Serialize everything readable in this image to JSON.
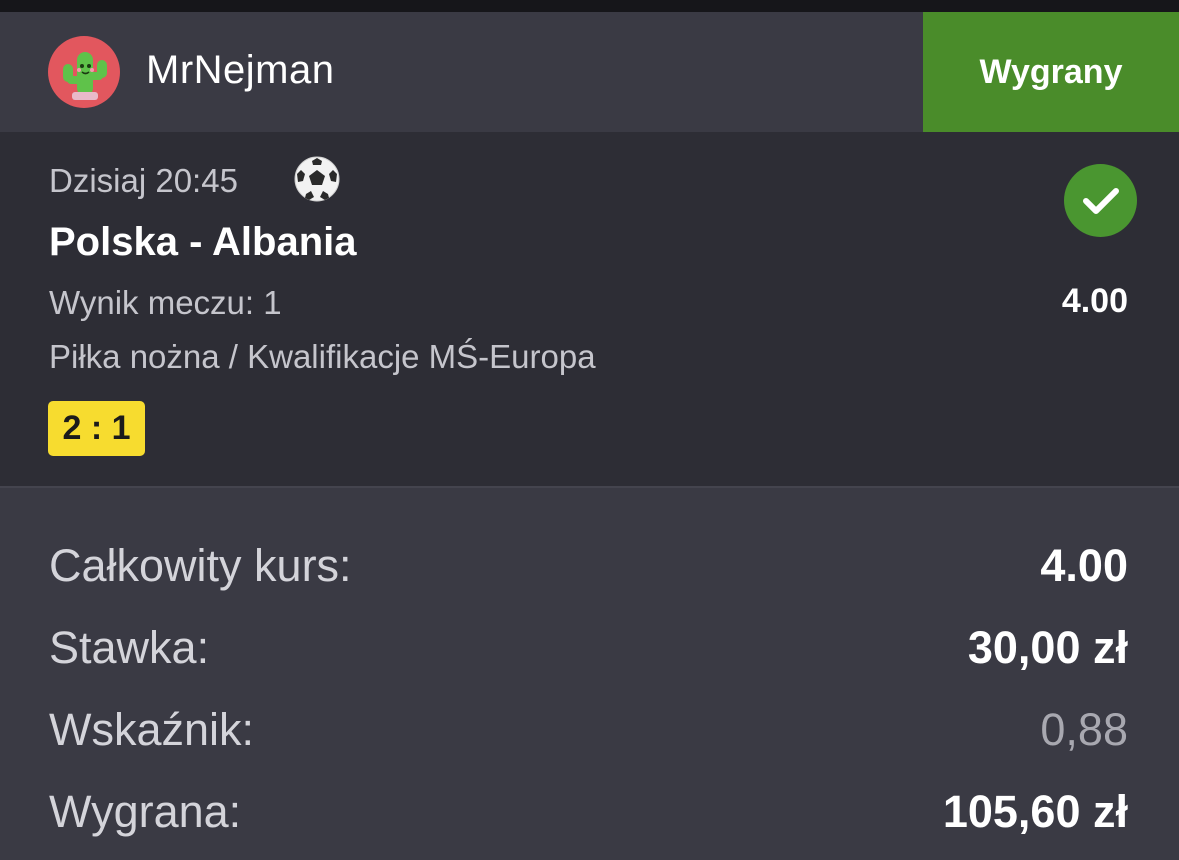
{
  "header": {
    "username": "MrNejman",
    "status_label": "Wygrany"
  },
  "bet": {
    "date": "Dzisiaj 20:45",
    "match": "Polska - Albania",
    "market": "Wynik meczu: 1",
    "odds": "4.00",
    "league": "Piłka nożna / Kwalifikacje MŚ-Europa",
    "score": "2 : 1"
  },
  "summary": {
    "total_odds_label": "Całkowity kurs:",
    "total_odds_value": "4.00",
    "stake_label": "Stawka:",
    "stake_value": "30,00 zł",
    "indicator_label": "Wskaźnik:",
    "indicator_value": "0,88",
    "win_label": "Wygrana:",
    "win_value": "105,60 zł"
  },
  "colors": {
    "status_green": "#4a8c2a",
    "score_yellow": "#f7dc2f",
    "card_bg": "#2d2d35",
    "page_bg": "#3a3a44"
  },
  "icons": {
    "avatar": "cactus-avatar-icon",
    "sport": "soccer-ball-icon",
    "result": "check-circle-icon"
  }
}
